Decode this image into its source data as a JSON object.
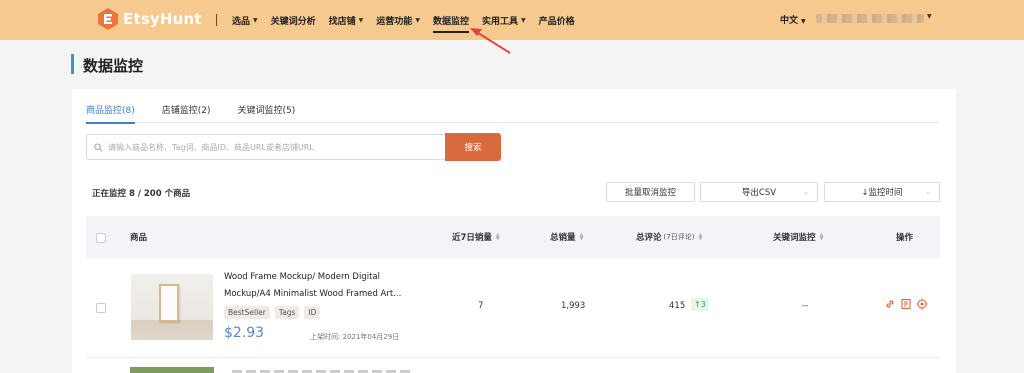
{
  "app": {
    "logo_text": "EtsyHunt",
    "colors": {
      "topbar": "#f6c98e",
      "accent": "#d96a3e",
      "link_blue": "#3f7fd8",
      "price_blue": "#5b8ac6",
      "up_green": "#3aa44a"
    }
  },
  "nav": {
    "items": [
      {
        "label": "选品",
        "has_dropdown": true
      },
      {
        "label": "关键词分析",
        "has_dropdown": false
      },
      {
        "label": "找店铺",
        "has_dropdown": true
      },
      {
        "label": "运营功能",
        "has_dropdown": true
      },
      {
        "label": "数据监控",
        "has_dropdown": false,
        "active": true
      },
      {
        "label": "实用工具",
        "has_dropdown": true
      },
      {
        "label": "产品价格",
        "has_dropdown": false
      }
    ],
    "language": "中文"
  },
  "page": {
    "title": "数据监控"
  },
  "tabs": [
    {
      "label": "商品监控(8)",
      "active": true
    },
    {
      "label": "店铺监控(2)",
      "active": false
    },
    {
      "label": "关键词监控(5)",
      "active": false
    }
  ],
  "search": {
    "placeholder": "请输入商品名称、Tag词、商品ID、商品URL或者店铺URL",
    "button_label": "搜索"
  },
  "toolbar": {
    "status": "正在监控 8 / 200 个商品",
    "bulk_cancel": "批量取消监控",
    "export": "导出CSV",
    "sort": "↓监控时间"
  },
  "table": {
    "headers": {
      "product": "商品",
      "sales7": "近7日销量",
      "total_sales": "总销量",
      "reviews": "总评论",
      "reviews_note": "(7日评论)",
      "keyword_monitor": "关键词监控",
      "actions": "操作"
    },
    "rows": [
      {
        "title_line1": "Wood Frame Mockup/ Modern Digital",
        "title_line2": "Mockup/A4 Minimalist Wood Framed Art...",
        "tags": [
          "BestSeller",
          "Tags",
          "ID"
        ],
        "price": "$2.93",
        "listed": "上架时间: 2021年04月29日",
        "sales7": "7",
        "total_sales": "1,993",
        "reviews": "415",
        "reviews_7d": "↑3",
        "keyword_monitor": "--",
        "action_icons": [
          "link-icon",
          "report-icon",
          "target-icon"
        ]
      }
    ]
  }
}
